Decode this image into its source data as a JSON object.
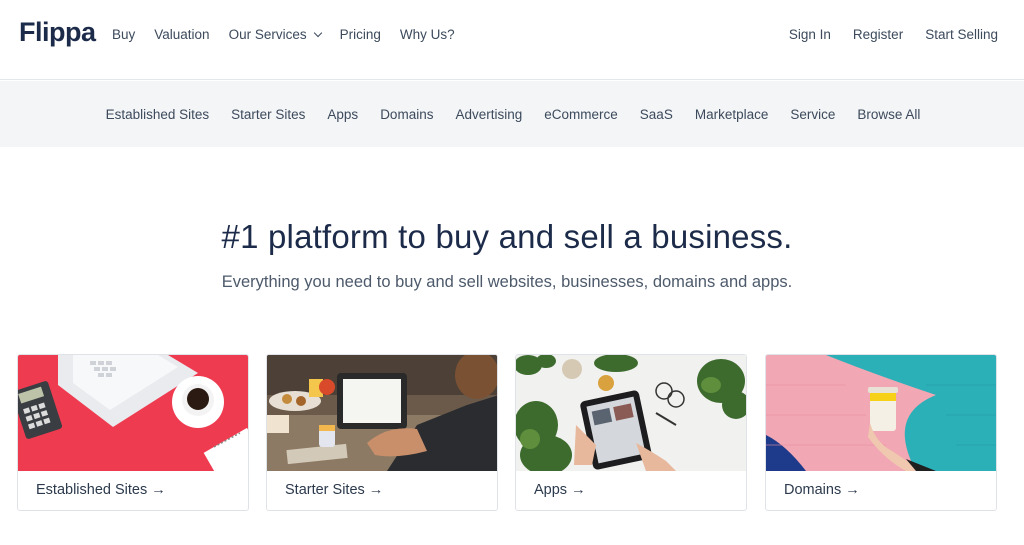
{
  "brand": {
    "logo": "Flippa"
  },
  "nav": {
    "left": [
      {
        "label": "Buy"
      },
      {
        "label": "Valuation"
      },
      {
        "label": "Our Services"
      },
      {
        "label": "Pricing"
      },
      {
        "label": "Why Us?"
      }
    ],
    "right": [
      {
        "label": "Sign In"
      },
      {
        "label": "Register"
      },
      {
        "label": "Start Selling"
      }
    ]
  },
  "categories": [
    "Established Sites",
    "Starter Sites",
    "Apps",
    "Domains",
    "Advertising",
    "eCommerce",
    "SaaS",
    "Marketplace",
    "Service",
    "Browse All"
  ],
  "hero": {
    "title": "#1 platform to buy and sell a business.",
    "subtitle": "Everything you need to buy and sell websites, businesses, domains and apps."
  },
  "cards": [
    {
      "label": "Established Sites →"
    },
    {
      "label": "Starter Sites →"
    },
    {
      "label": "Apps →"
    },
    {
      "label": "Domains →"
    }
  ],
  "colors": {
    "brand_navy": "#1c2b49",
    "nav_text": "#3c4a5c",
    "category_bar_bg": "#f4f5f7",
    "card_red": "#ef3b50",
    "card_pink": "#f2a7b4",
    "card_teal": "#2bb0b8"
  }
}
